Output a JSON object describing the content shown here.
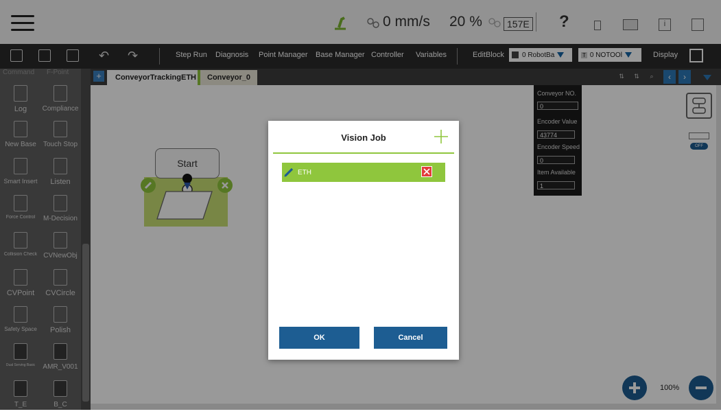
{
  "status_bar": {
    "speed_text": "0 mm/s",
    "percent_text": "20 %",
    "counter_text": "157E",
    "help_text": "?"
  },
  "toolbar": {
    "step_run": "Step Run",
    "diagnosis": "Diagnosis",
    "point_manager": "Point Manager",
    "base_manager": "Base Manager",
    "controller": "Controller",
    "variables": "Variables",
    "editblock": "EditBlock",
    "robot_base_select": "0 RobotBa",
    "tool_select": "0 NOTOOl",
    "tool_prefix": "T",
    "display": "Display"
  },
  "sidebar": {
    "header_left": "Command",
    "header_right": "F-Point",
    "items": [
      {
        "label": "Log",
        "icon": "log-icon"
      },
      {
        "label": "Compliance",
        "icon": "compliance-icon"
      },
      {
        "label": "New Base",
        "icon": "new-base-icon"
      },
      {
        "label": "Touch Stop",
        "icon": "touch-stop-icon"
      },
      {
        "label": "Smart Insert",
        "icon": "smart-insert-icon"
      },
      {
        "label": "Listen",
        "icon": "listen-icon"
      },
      {
        "label": "Force Control",
        "icon": "force-control-icon"
      },
      {
        "label": "M-Decision",
        "icon": "m-decision-icon"
      },
      {
        "label": "Collision Check",
        "icon": "collision-check-icon"
      },
      {
        "label": "CVNewObj",
        "icon": "cv-new-obj-icon"
      },
      {
        "label": "CVPoint",
        "icon": "cv-point-icon"
      },
      {
        "label": "CVCircle",
        "icon": "cv-circle-icon"
      },
      {
        "label": "Safety Space",
        "icon": "safety-space-icon"
      },
      {
        "label": "Polish",
        "icon": "polish-icon"
      },
      {
        "label": "Dual Serving Basic",
        "icon": "dual-serving-icon"
      },
      {
        "label": "AMR_V001",
        "icon": "amr-icon"
      },
      {
        "label": "T_E",
        "icon": "te-icon"
      },
      {
        "label": "B_C",
        "icon": "bc-icon"
      }
    ]
  },
  "tabs": {
    "add": "+",
    "main": "ConveyorTrackingETH",
    "conveyor": "Conveyor_0"
  },
  "flow": {
    "start_label": "Start"
  },
  "conveyor_panel": {
    "no_label": "Conveyor NO.",
    "no_value": "0",
    "encoder_value_label": "Encoder Value",
    "encoder_value": "43774",
    "encoder_speed_label": "Encoder Speed",
    "encoder_speed": "0",
    "item_available_label": "Item Available",
    "item_available": "1"
  },
  "right_panel": {
    "toggle_text": "OFF"
  },
  "modal": {
    "title": "Vision Job",
    "jobs": [
      {
        "name": "ETH"
      }
    ],
    "ok": "OK",
    "cancel": "Cancel"
  },
  "zoom": {
    "level": "100%"
  },
  "colors": {
    "accent_green": "#8fc63d",
    "button_blue": "#1d5d92",
    "delete_red": "#e23b3b"
  }
}
